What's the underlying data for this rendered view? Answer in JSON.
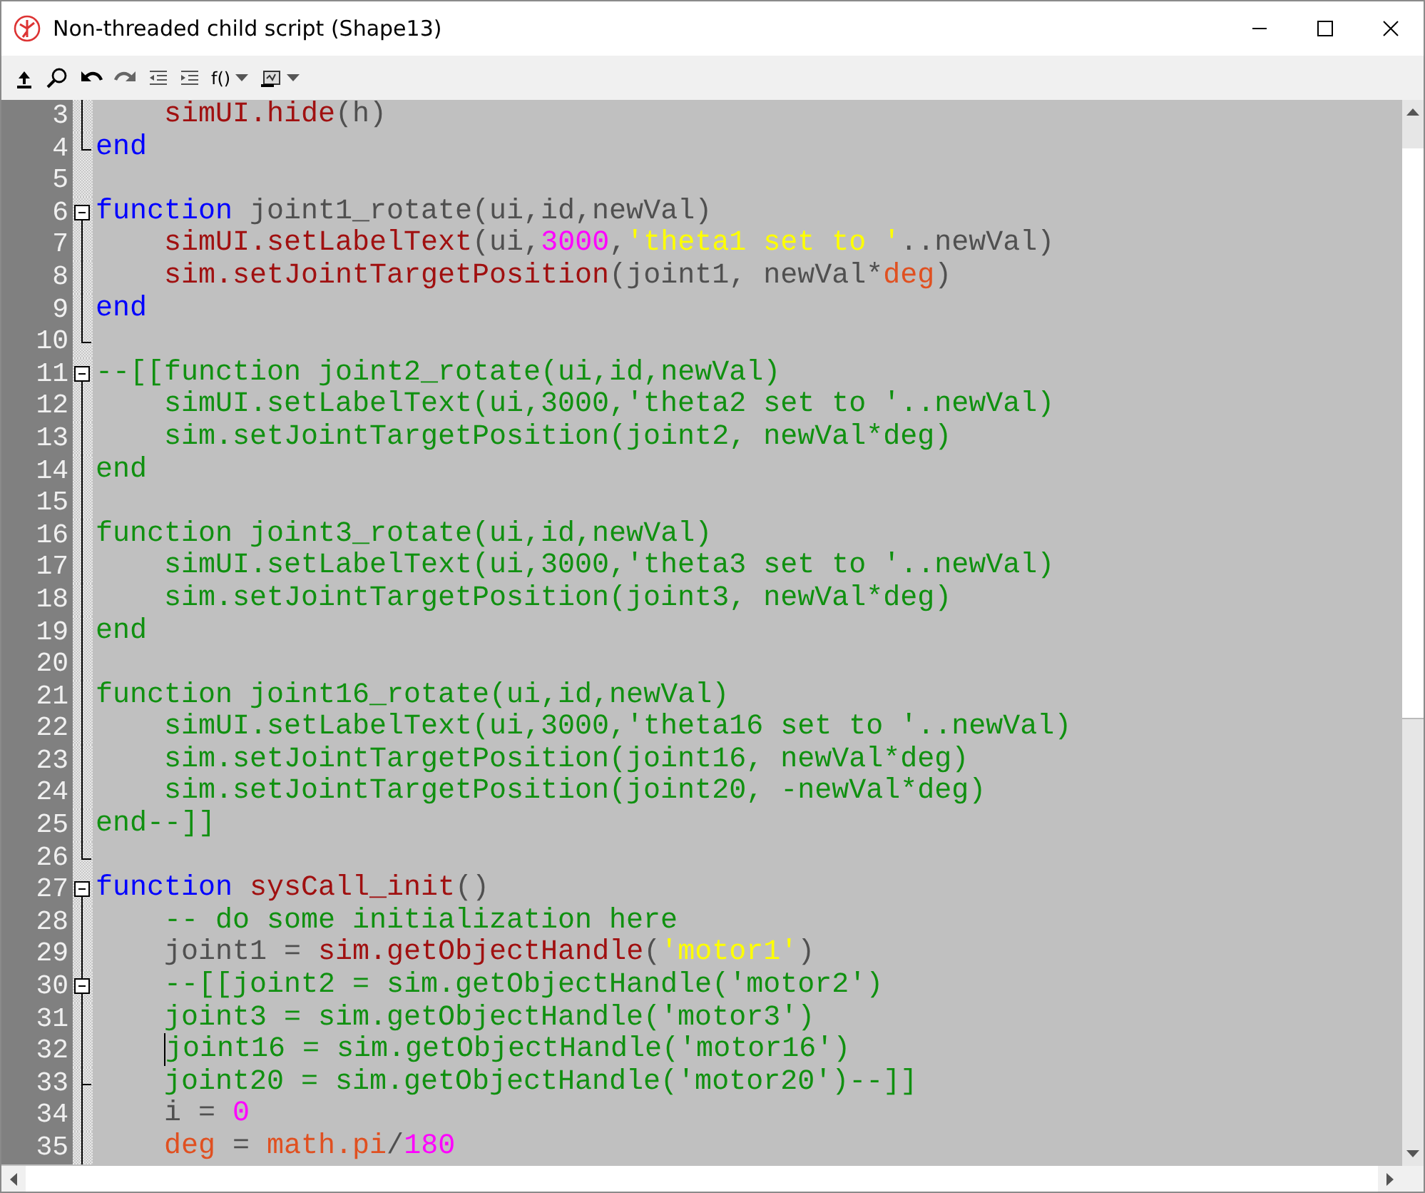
{
  "window": {
    "title": "Non-threaded child script (Shape13)"
  },
  "toolbar": {
    "function_menu": "f()"
  },
  "editor": {
    "fold_open_at_top": true,
    "lines": [
      {
        "number": "3",
        "indented": true,
        "fold_start": false,
        "fold_end": false,
        "caret": false,
        "tokens": [
          {
            "kind": "api",
            "t": "simUI.hide"
          },
          {
            "kind": "id",
            "t": "(h)"
          }
        ]
      },
      {
        "number": "4",
        "indented": false,
        "fold_start": false,
        "fold_end": true,
        "caret": false,
        "tokens": [
          {
            "kind": "kw",
            "t": "end"
          }
        ]
      },
      {
        "number": "5",
        "indented": false,
        "fold_start": false,
        "fold_end": false,
        "caret": false
      },
      {
        "number": "6",
        "indented": false,
        "fold_start": true,
        "fold_end": false,
        "caret": false,
        "tokens": [
          {
            "kind": "kw",
            "t": "function"
          },
          {
            "kind": "id",
            "t": " joint1_rotate(ui,id,newVal)"
          }
        ]
      },
      {
        "number": "7",
        "indented": true,
        "fold_start": false,
        "fold_end": false,
        "caret": false,
        "tokens": [
          {
            "kind": "api",
            "t": "simUI.setLabelText"
          },
          {
            "kind": "id",
            "t": "(ui,"
          },
          {
            "kind": "num",
            "t": "3000"
          },
          {
            "kind": "id",
            "t": ","
          },
          {
            "kind": "str",
            "t": "'theta1 set to '"
          },
          {
            "kind": "id",
            "t": "..newVal)"
          }
        ]
      },
      {
        "number": "8",
        "indented": true,
        "fold_start": false,
        "fold_end": false,
        "caret": false,
        "tokens": [
          {
            "kind": "api",
            "t": "sim.setJointTargetPosition"
          },
          {
            "kind": "id",
            "t": "(joint1, newVal*"
          },
          {
            "kind": "var",
            "t": "deg"
          },
          {
            "kind": "id",
            "t": ")"
          }
        ]
      },
      {
        "number": "9",
        "indented": false,
        "fold_start": false,
        "fold_end": false,
        "caret": false,
        "tokens": [
          {
            "kind": "kw",
            "t": "end"
          }
        ]
      },
      {
        "number": "10",
        "indented": false,
        "fold_start": false,
        "fold_end": true,
        "caret": false
      },
      {
        "number": "11",
        "indented": false,
        "fold_start": true,
        "fold_end": false,
        "caret": false,
        "tokens": [
          {
            "kind": "cmt",
            "t": "--[[function joint2_rotate(ui,id,newVal)"
          }
        ]
      },
      {
        "number": "12",
        "indented": true,
        "fold_start": false,
        "fold_end": false,
        "caret": false,
        "tokens": [
          {
            "kind": "cmt",
            "t": "simUI.setLabelText(ui,3000,'theta2 set to '..newVal)"
          }
        ]
      },
      {
        "number": "13",
        "indented": true,
        "fold_start": false,
        "fold_end": false,
        "caret": false,
        "tokens": [
          {
            "kind": "cmt",
            "t": "sim.setJointTargetPosition(joint2, newVal*deg)"
          }
        ]
      },
      {
        "number": "14",
        "indented": false,
        "fold_start": false,
        "fold_end": false,
        "caret": false,
        "tokens": [
          {
            "kind": "cmt",
            "t": "end"
          }
        ]
      },
      {
        "number": "15",
        "indented": false,
        "fold_start": false,
        "fold_end": false,
        "caret": false
      },
      {
        "number": "16",
        "indented": false,
        "fold_start": false,
        "fold_end": false,
        "caret": false,
        "tokens": [
          {
            "kind": "cmt",
            "t": "function joint3_rotate(ui,id,newVal)"
          }
        ]
      },
      {
        "number": "17",
        "indented": true,
        "fold_start": false,
        "fold_end": false,
        "caret": false,
        "tokens": [
          {
            "kind": "cmt",
            "t": "simUI.setLabelText(ui,3000,'theta3 set to '..newVal)"
          }
        ]
      },
      {
        "number": "18",
        "indented": true,
        "fold_start": false,
        "fold_end": false,
        "caret": false,
        "tokens": [
          {
            "kind": "cmt",
            "t": "sim.setJointTargetPosition(joint3, newVal*deg)"
          }
        ]
      },
      {
        "number": "19",
        "indented": false,
        "fold_start": false,
        "fold_end": false,
        "caret": false,
        "tokens": [
          {
            "kind": "cmt",
            "t": "end"
          }
        ]
      },
      {
        "number": "20",
        "indented": false,
        "fold_start": false,
        "fold_end": false,
        "caret": false
      },
      {
        "number": "21",
        "indented": false,
        "fold_start": false,
        "fold_end": false,
        "caret": false,
        "tokens": [
          {
            "kind": "cmt",
            "t": "function joint16_rotate(ui,id,newVal)"
          }
        ]
      },
      {
        "number": "22",
        "indented": true,
        "fold_start": false,
        "fold_end": false,
        "caret": false,
        "tokens": [
          {
            "kind": "cmt",
            "t": "simUI.setLabelText(ui,3000,'theta16 set to '..newVal)"
          }
        ]
      },
      {
        "number": "23",
        "indented": true,
        "fold_start": false,
        "fold_end": false,
        "caret": false,
        "tokens": [
          {
            "kind": "cmt",
            "t": "sim.setJointTargetPosition(joint16, newVal*deg)"
          }
        ]
      },
      {
        "number": "24",
        "indented": true,
        "fold_start": false,
        "fold_end": false,
        "caret": false,
        "tokens": [
          {
            "kind": "cmt",
            "t": "sim.setJointTargetPosition(joint20, -newVal*deg)"
          }
        ]
      },
      {
        "number": "25",
        "indented": false,
        "fold_start": false,
        "fold_end": false,
        "caret": false,
        "tokens": [
          {
            "kind": "cmt",
            "t": "end--]]"
          }
        ]
      },
      {
        "number": "26",
        "indented": false,
        "fold_start": false,
        "fold_end": true,
        "caret": false
      },
      {
        "number": "27",
        "indented": false,
        "fold_start": true,
        "fold_end": false,
        "caret": false,
        "tokens": [
          {
            "kind": "kw",
            "t": "function"
          },
          {
            "kind": "api",
            "t": " sysCall_init"
          },
          {
            "kind": "id",
            "t": "()"
          }
        ]
      },
      {
        "number": "28",
        "indented": true,
        "fold_start": false,
        "fold_end": false,
        "caret": false,
        "tokens": [
          {
            "kind": "cmt",
            "t": "-- do some initialization here"
          }
        ]
      },
      {
        "number": "29",
        "indented": true,
        "fold_start": false,
        "fold_end": false,
        "caret": false,
        "tokens": [
          {
            "kind": "id",
            "t": "joint1 = "
          },
          {
            "kind": "api",
            "t": "sim.getObjectHandle"
          },
          {
            "kind": "id",
            "t": "("
          },
          {
            "kind": "str",
            "t": "'motor1'"
          },
          {
            "kind": "id",
            "t": ")"
          }
        ]
      },
      {
        "number": "30",
        "indented": true,
        "fold_start": true,
        "fold_end": false,
        "caret": false,
        "tokens": [
          {
            "kind": "cmt",
            "t": "--[[joint2 = sim.getObjectHandle('motor2')"
          }
        ]
      },
      {
        "number": "31",
        "indented": true,
        "fold_start": false,
        "fold_end": false,
        "caret": false,
        "tokens": [
          {
            "kind": "cmt",
            "t": "joint3 = sim.getObjectHandle('motor3')"
          }
        ]
      },
      {
        "number": "32",
        "indented": true,
        "fold_start": false,
        "fold_end": false,
        "caret": true,
        "tokens": [
          {
            "kind": "cmt",
            "t": "joint16 = sim.getObjectHandle('motor16')"
          }
        ]
      },
      {
        "number": "33",
        "indented": true,
        "fold_start": false,
        "fold_end": true,
        "caret": false,
        "tokens": [
          {
            "kind": "cmt",
            "t": "joint20 = sim.getObjectHandle('motor20')--]]"
          }
        ]
      },
      {
        "number": "34",
        "indented": true,
        "fold_start": false,
        "fold_end": false,
        "caret": false,
        "tokens": [
          {
            "kind": "id",
            "t": "i = "
          },
          {
            "kind": "num",
            "t": "0"
          }
        ]
      },
      {
        "number": "35",
        "indented": true,
        "fold_start": false,
        "fold_end": false,
        "caret": false,
        "tokens": [
          {
            "kind": "var",
            "t": "deg"
          },
          {
            "kind": "id",
            "t": " = "
          },
          {
            "kind": "var",
            "t": "math.pi"
          },
          {
            "kind": "id",
            "t": "/"
          },
          {
            "kind": "num",
            "t": "180"
          }
        ]
      }
    ]
  }
}
